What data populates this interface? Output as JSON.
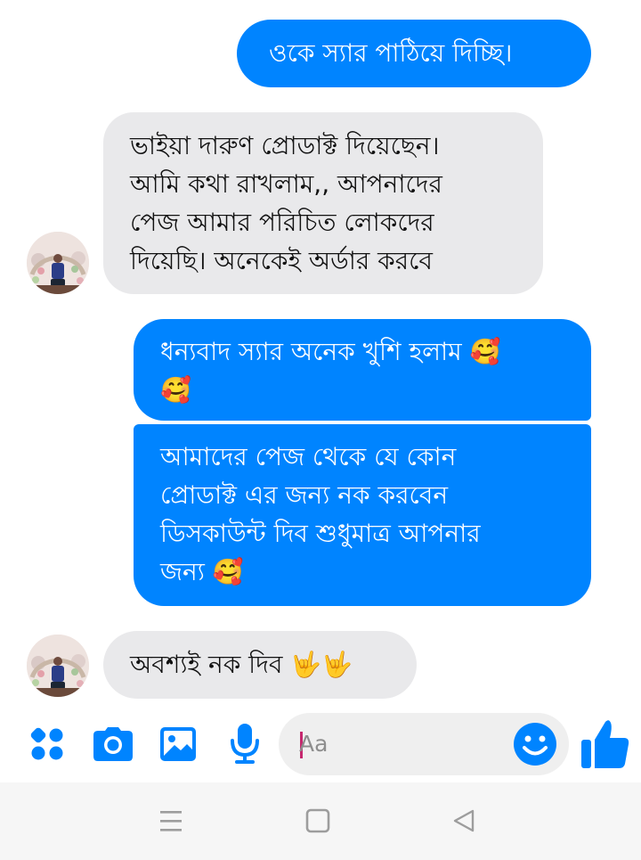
{
  "messages": [
    {
      "direction": "outgoing",
      "text": "ওকে স্যার  পাঠিয়ে দিচ্ছি।"
    },
    {
      "direction": "incoming",
      "text": "ভাইয়া দারুণ প্রোডাক্ট দিয়েছেন।\nআমি কথা রাখলাম,, আপনাদের\nপেজ আমার পরিচিত লোকদের\nদিয়েছি। অনেকেই অর্ডার করবে"
    },
    {
      "direction": "outgoing",
      "text": "ধন্যবাদ স্যার অনেক খুশি হলাম 🥰\n🥰"
    },
    {
      "direction": "outgoing",
      "text": "আমাদের পেজ থেকে যে কোন\nপ্রোডাক্ট এর জন্য নক করবেন\nডিসকাউন্ট দিব শুধুমাত্র আপনার\nজন্য 🥰"
    },
    {
      "direction": "incoming",
      "text": "অবশ্যই নক দিব 🤟🤟"
    }
  ],
  "composer": {
    "placeholder": "Aa",
    "icons": [
      "apps-grid-icon",
      "camera-icon",
      "gallery-icon",
      "microphone-icon",
      "emoji-smile-icon",
      "thumbs-up-icon"
    ]
  },
  "navigation_bar": {
    "icons": [
      "recent-apps-icon",
      "home-icon",
      "back-icon"
    ]
  },
  "colors": {
    "outgoing_bubble": "#0084ff",
    "incoming_bubble": "#e9e9eb",
    "accent": "#0084ff",
    "composer_pill": "#efefef",
    "nav_bar": "#f6f6f6"
  }
}
